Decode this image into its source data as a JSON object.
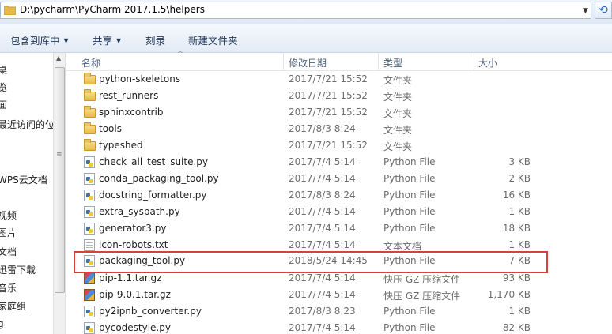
{
  "address_bar": {
    "path": "D:\\pycharm\\PyCharm 2017.1.5\\helpers"
  },
  "toolbar": {
    "include_in_library": "包含到库中",
    "share": "共享",
    "burn": "刻录",
    "new_folder": "新建文件夹"
  },
  "nav": {
    "items": [
      "桌",
      "览",
      "面",
      "最近访问的位置",
      "",
      "WPS云文档",
      "",
      "视频",
      "图片",
      "文档",
      "迅雷下载",
      "音乐",
      "家庭组",
      "g"
    ]
  },
  "columns": {
    "name": "名称",
    "date": "修改日期",
    "type": "类型",
    "size": "大小"
  },
  "files": [
    {
      "name": "python-skeletons",
      "date": "2017/7/21 15:52",
      "type": "文件夹",
      "size": "",
      "icon": "folder-icon"
    },
    {
      "name": "rest_runners",
      "date": "2017/7/21 15:52",
      "type": "文件夹",
      "size": "",
      "icon": "folder-icon"
    },
    {
      "name": "sphinxcontrib",
      "date": "2017/7/21 15:52",
      "type": "文件夹",
      "size": "",
      "icon": "folder-icon"
    },
    {
      "name": "tools",
      "date": "2017/8/3 8:24",
      "type": "文件夹",
      "size": "",
      "icon": "folder-icon"
    },
    {
      "name": "typeshed",
      "date": "2017/7/21 15:52",
      "type": "文件夹",
      "size": "",
      "icon": "folder-icon"
    },
    {
      "name": "check_all_test_suite.py",
      "date": "2017/7/4 5:14",
      "type": "Python File",
      "size": "3 KB",
      "icon": "python-file-icon"
    },
    {
      "name": "conda_packaging_tool.py",
      "date": "2017/7/4 5:14",
      "type": "Python File",
      "size": "2 KB",
      "icon": "python-file-icon"
    },
    {
      "name": "docstring_formatter.py",
      "date": "2017/8/3 8:24",
      "type": "Python File",
      "size": "16 KB",
      "icon": "python-file-icon"
    },
    {
      "name": "extra_syspath.py",
      "date": "2017/7/4 5:14",
      "type": "Python File",
      "size": "1 KB",
      "icon": "python-file-icon"
    },
    {
      "name": "generator3.py",
      "date": "2017/7/4 5:14",
      "type": "Python File",
      "size": "18 KB",
      "icon": "python-file-icon"
    },
    {
      "name": "icon-robots.txt",
      "date": "2017/7/4 5:14",
      "type": "文本文档",
      "size": "1 KB",
      "icon": "text-file-icon"
    },
    {
      "name": "packaging_tool.py",
      "date": "2018/5/24 14:45",
      "type": "Python File",
      "size": "7 KB",
      "icon": "python-file-icon"
    },
    {
      "name": "pip-1.1.tar.gz",
      "date": "2017/7/4 5:14",
      "type": "快压 GZ 压缩文件",
      "size": "93 KB",
      "icon": "archive-icon"
    },
    {
      "name": "pip-9.0.1.tar.gz",
      "date": "2017/7/4 5:14",
      "type": "快压 GZ 压缩文件",
      "size": "1,170 KB",
      "icon": "archive-icon"
    },
    {
      "name": "py2ipnb_converter.py",
      "date": "2017/8/3 8:23",
      "type": "Python File",
      "size": "1 KB",
      "icon": "python-file-icon"
    },
    {
      "name": "pycodestyle.py",
      "date": "2017/7/4 5:14",
      "type": "Python File",
      "size": "82 KB",
      "icon": "python-file-icon"
    }
  ],
  "colors": {
    "highlight": "#d9403a",
    "toolbar_text": "#1e3557"
  }
}
